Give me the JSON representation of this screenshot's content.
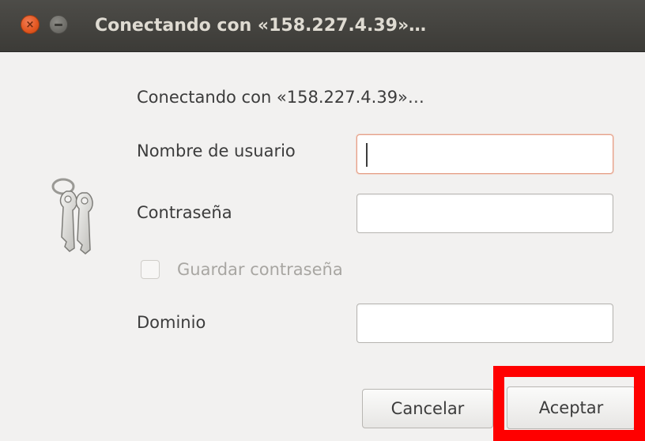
{
  "window": {
    "title": "Conectando con «158.227.4.39»…",
    "controls": {
      "close_glyph": "×",
      "minimize_glyph": "–"
    }
  },
  "dialog": {
    "icon": "keys-icon",
    "message": "Conectando con «158.227.4.39»…",
    "fields": {
      "username": {
        "label": "Nombre de usuario",
        "value": "",
        "placeholder": "",
        "focused": true
      },
      "password": {
        "label": "Contraseña",
        "value": "",
        "placeholder": ""
      },
      "domain": {
        "label": "Dominio",
        "value": "",
        "placeholder": ""
      }
    },
    "remember_password": {
      "label": "Guardar contraseña",
      "checked": false,
      "enabled": false
    },
    "buttons": {
      "cancel": "Cancelar",
      "accept": "Aceptar"
    }
  },
  "colors": {
    "titlebar": "#3c3b37",
    "title_text": "#dfdbd2",
    "close_button": "#e2561f",
    "focus_border": "#e5a089",
    "highlight": "#ff0000"
  }
}
